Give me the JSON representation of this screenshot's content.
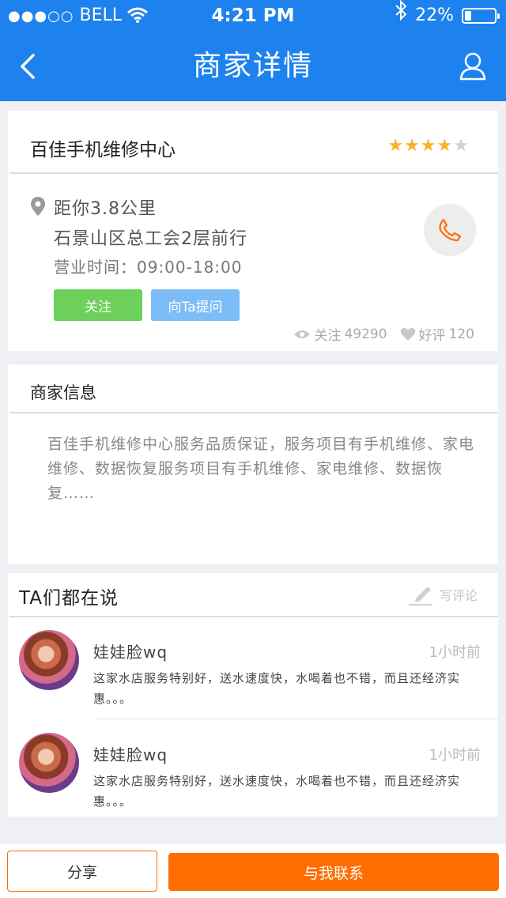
{
  "status_bar": {
    "signal": "●●●○○",
    "carrier": "BELL",
    "time": "4:21 PM",
    "battery_text": "22%",
    "battery_level": 0.22
  },
  "nav": {
    "title": "商家详情",
    "back_icon": "chevron-left-icon",
    "user_icon": "user-icon"
  },
  "shop": {
    "name": "百佳手机维修中心",
    "rating": 4,
    "rating_max": 5,
    "distance": "距你3.8公里",
    "address": "石景山区总工会2层前行",
    "hours": "营业时间：09:00-18:00",
    "follow_label": "关注",
    "ask_label": "向Ta提问",
    "stats": {
      "follow_label": "关注",
      "follow_count": "49290",
      "good_label": "好评",
      "good_count": "120"
    },
    "colors": {
      "star": "#f7b22b",
      "follow_btn": "#6cd05a",
      "ask_btn": "#7cbcf7",
      "phone": "#ff6d00"
    }
  },
  "info": {
    "title": "商家信息",
    "text": "百佳手机维修中心服务品质保证，服务项目有手机维修、家电维修、数据恢复服务项目有手机维修、家电维修、数据恢复……"
  },
  "comments": {
    "title": "TA们都在说",
    "write_label": "写评论",
    "items": [
      {
        "user": "娃娃脸wq",
        "time": "1小时前",
        "text": "这家水店服务特别好，送水速度快，水喝着也不错，而且还经济实惠。。。"
      },
      {
        "user": "娃娃脸wq",
        "time": "1小时前",
        "text": "这家水店服务特别好，送水速度快，水喝着也不错，而且还经济实惠。。。"
      }
    ]
  },
  "bottom": {
    "share_label": "分享",
    "contact_label": "与我联系"
  },
  "theme": {
    "primary": "#1e82ee",
    "accent": "#ff6d00"
  }
}
